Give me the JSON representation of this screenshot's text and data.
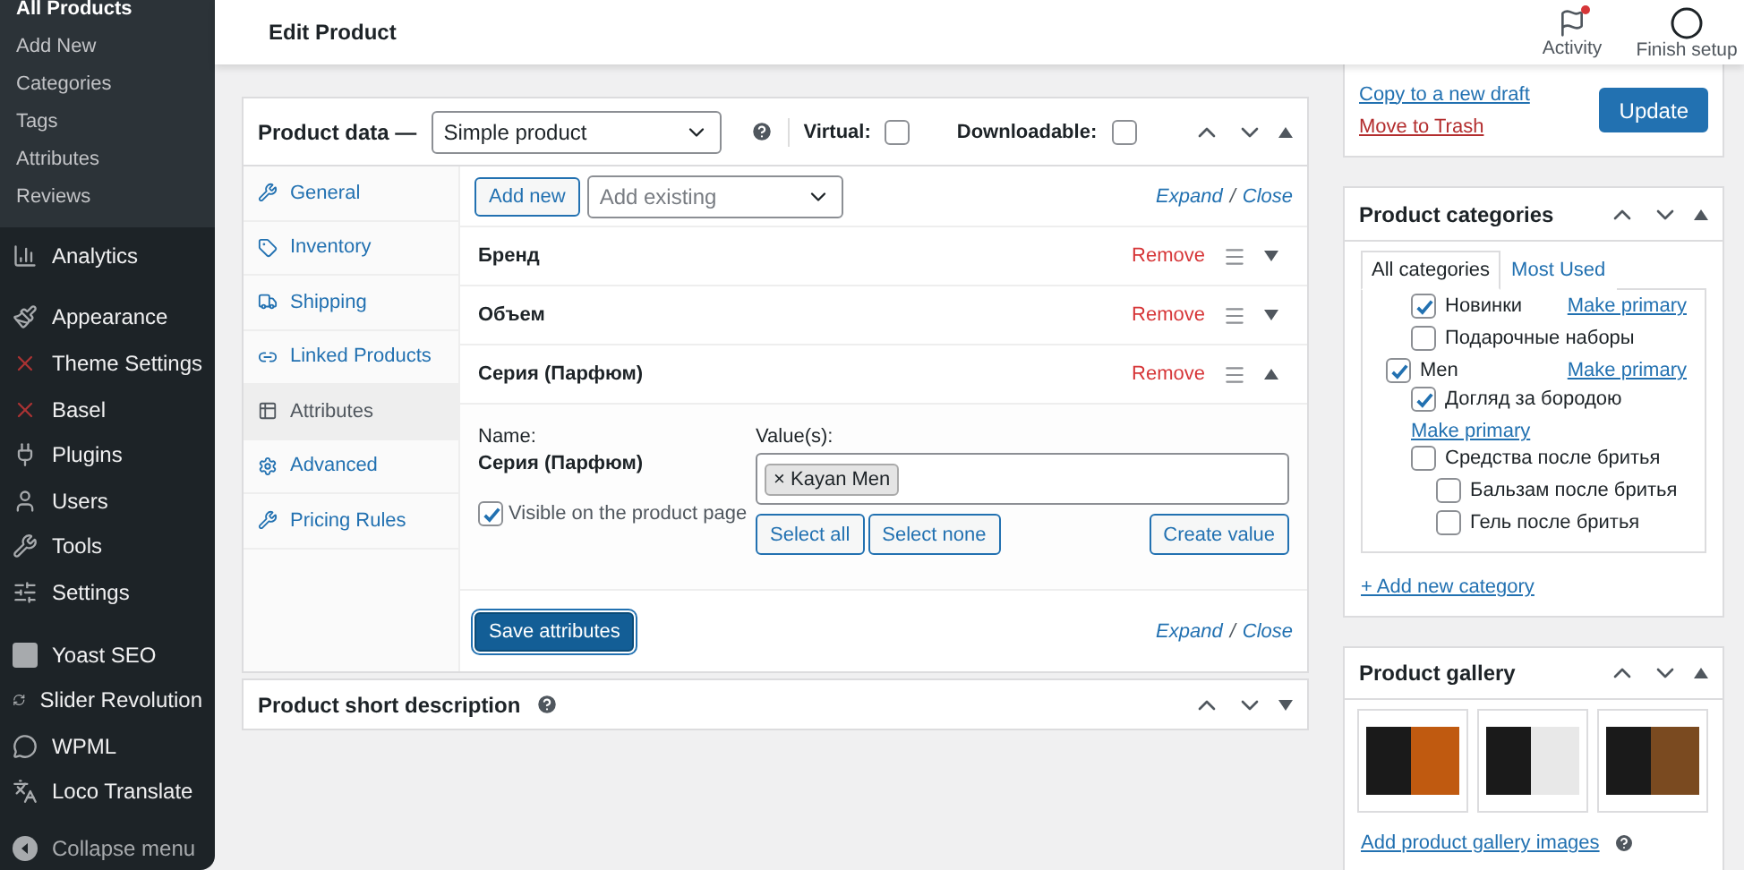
{
  "sidebar": {
    "submenu": [
      {
        "label": "All Products",
        "selected": true
      },
      {
        "label": "Add New",
        "selected": false
      },
      {
        "label": "Categories",
        "selected": false
      },
      {
        "label": "Tags",
        "selected": false
      },
      {
        "label": "Attributes",
        "selected": false
      },
      {
        "label": "Reviews",
        "selected": false
      }
    ],
    "menu_groups": [
      [
        "Analytics"
      ],
      [
        "Appearance",
        "Theme Settings",
        "Basel",
        "Plugins",
        "Users",
        "Tools",
        "Settings"
      ],
      [
        "Yoast SEO",
        "Slider Revolution",
        "WPML",
        "Loco Translate"
      ]
    ],
    "collapse": "Collapse menu"
  },
  "header": {
    "title": "Edit Product",
    "actions": [
      {
        "label": "Activity",
        "notification": true
      },
      {
        "label": "Finish setup"
      }
    ]
  },
  "product_data": {
    "title": "Product data —",
    "type": "Simple product",
    "virtual": {
      "label": "Virtual:",
      "checked": false
    },
    "downloadable": {
      "label": "Downloadable:",
      "checked": false
    },
    "tabs": [
      {
        "label": "General",
        "selected": false
      },
      {
        "label": "Inventory",
        "selected": false
      },
      {
        "label": "Shipping",
        "selected": false
      },
      {
        "label": "Linked Products",
        "selected": false
      },
      {
        "label": "Attributes",
        "selected": true
      },
      {
        "label": "Advanced",
        "selected": false
      },
      {
        "label": "Pricing Rules",
        "selected": false
      }
    ],
    "add_new": "Add new",
    "add_existing": {
      "placeholder": "Add existing"
    },
    "toolbar_links": {
      "expand": "Expand",
      "separator": "/",
      "close": "Close"
    },
    "attributes": [
      {
        "name": "Бренд",
        "remove": "Remove",
        "expanded": false
      },
      {
        "name": "Объем",
        "remove": "Remove",
        "expanded": false
      },
      {
        "name": "Серия (Парфюм)",
        "remove": "Remove",
        "expanded": true,
        "name_label": "Name:",
        "name_value": "Серия (Парфюм)",
        "values_label": "Value(s):",
        "values": [
          {
            "remove": "×",
            "label": "Kayan Men"
          }
        ],
        "visible": {
          "label": "Visible on the product page",
          "checked": true
        },
        "buttons": [
          "Select all",
          "Select none"
        ],
        "create": "Create value"
      }
    ],
    "save": "Save attributes",
    "footer_links": {
      "expand": "Expand",
      "separator": "/",
      "close": "Close"
    }
  },
  "short_description": {
    "title": "Product short description"
  },
  "publish": {
    "copy": "Copy to a new draft",
    "trash": "Move to Trash",
    "update": "Update"
  },
  "categories": {
    "title": "Product categories",
    "tabs": [
      {
        "label": "All categories",
        "selected": true
      },
      {
        "label": "Most Used",
        "selected": false
      }
    ],
    "items": [
      {
        "children": [
          {
            "label": "Новинки",
            "checked": true,
            "primary": "Make primary"
          },
          {
            "label": "Подарочные наборы",
            "checked": false
          }
        ]
      },
      {
        "label": "Men",
        "checked": true,
        "primary": "Make primary",
        "children": [
          {
            "label": "Догляд за бородою",
            "checked": true,
            "primary": "Make primary"
          },
          {
            "label": "Средства после бритья",
            "checked": false,
            "children": [
              {
                "label": "Бальзам после бритья",
                "checked": false
              },
              {
                "label": "Гель после бритья",
                "checked": false
              }
            ]
          }
        ]
      }
    ],
    "add": "+ Add new category"
  },
  "gallery": {
    "title": "Product gallery",
    "images": [
      {
        "kind": "label"
      },
      {
        "kind": "portrait"
      },
      {
        "kind": "texture"
      }
    ],
    "add": "Add product gallery images"
  }
}
